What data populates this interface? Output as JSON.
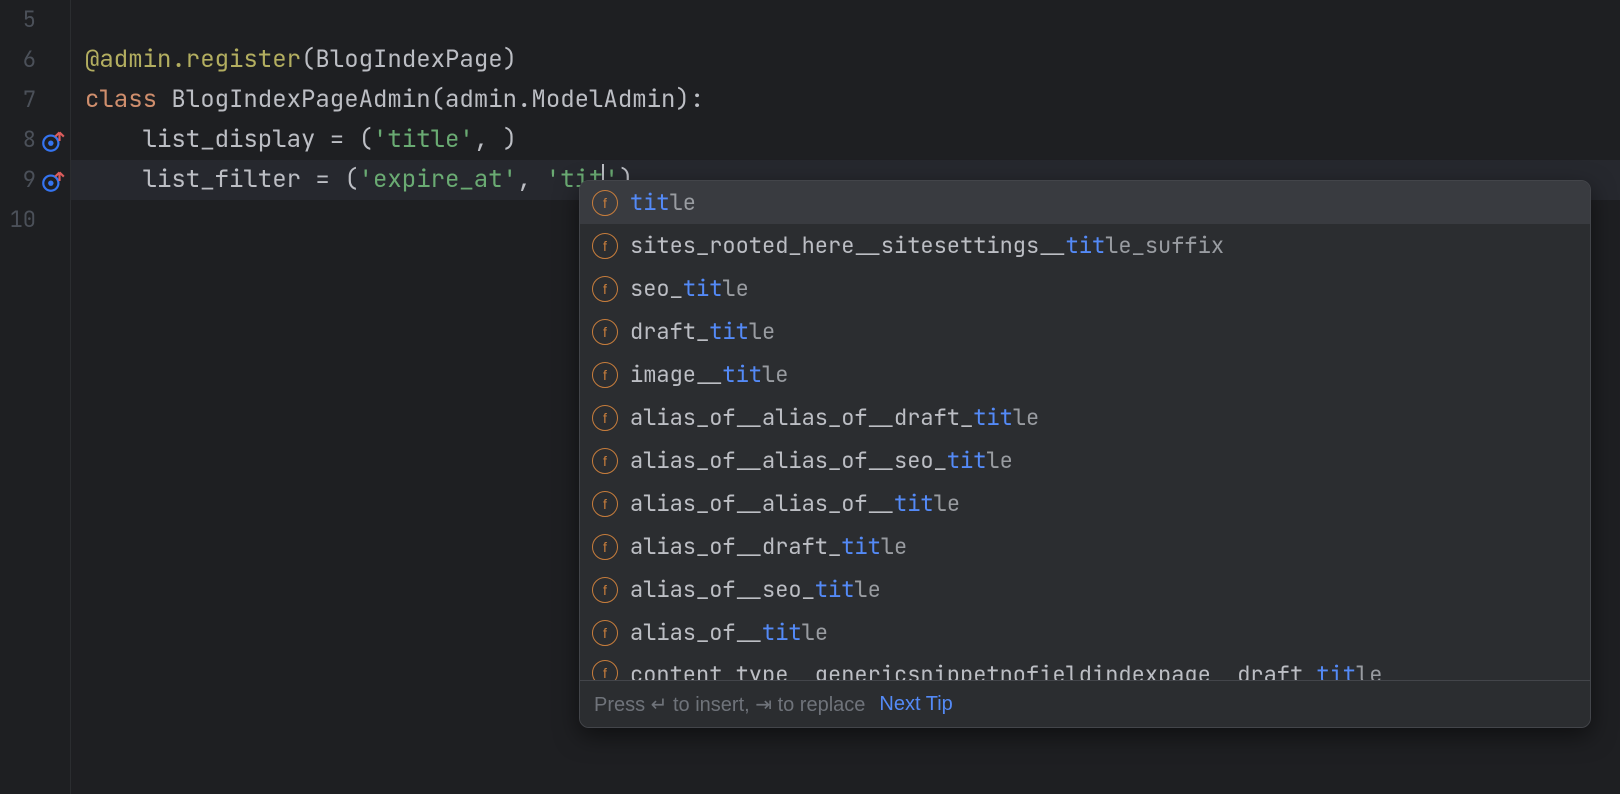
{
  "lines": {
    "5": "5",
    "6": "6",
    "7": "7",
    "8": "8",
    "9": "9",
    "10": "10"
  },
  "code": {
    "l6": {
      "decorator_at": "@",
      "decorator_name": "admin.register",
      "paren_open": "(",
      "arg": "BlogIndexPage",
      "paren_close": ")"
    },
    "l7": {
      "kw_class": "class ",
      "name": "BlogIndexPageAdmin",
      "paren_open": "(",
      "base": "admin.ModelAdmin",
      "paren_close": "):"
    },
    "l8": {
      "indent": "    ",
      "attr": "list_display = (",
      "s1": "'title'",
      "rest": ", )"
    },
    "l9": {
      "indent": "    ",
      "attr": "list_filter = (",
      "s1": "'expire_at'",
      "mid": ", ",
      "s2a": "'tit",
      "s2b": "'",
      "rest": ")"
    }
  },
  "completion": {
    "badge": "f",
    "items": [
      {
        "parts": [
          {
            "t": "tit",
            "hl": true
          },
          {
            "t": "le",
            "hl": false,
            "rest": true
          }
        ]
      },
      {
        "parts": [
          {
            "t": "sites_rooted_here__sitesettings__",
            "hl": false
          },
          {
            "t": "tit",
            "hl": true
          },
          {
            "t": "le_suffix",
            "hl": false,
            "rest": true
          }
        ]
      },
      {
        "parts": [
          {
            "t": "seo_",
            "hl": false
          },
          {
            "t": "tit",
            "hl": true
          },
          {
            "t": "le",
            "hl": false,
            "rest": true
          }
        ]
      },
      {
        "parts": [
          {
            "t": "draft_",
            "hl": false
          },
          {
            "t": "tit",
            "hl": true
          },
          {
            "t": "le",
            "hl": false,
            "rest": true
          }
        ]
      },
      {
        "parts": [
          {
            "t": "image__",
            "hl": false
          },
          {
            "t": "tit",
            "hl": true
          },
          {
            "t": "le",
            "hl": false,
            "rest": true
          }
        ]
      },
      {
        "parts": [
          {
            "t": "alias_of__alias_of__draft_",
            "hl": false
          },
          {
            "t": "tit",
            "hl": true
          },
          {
            "t": "le",
            "hl": false,
            "rest": true
          }
        ]
      },
      {
        "parts": [
          {
            "t": "alias_of__alias_of__seo_",
            "hl": false
          },
          {
            "t": "tit",
            "hl": true
          },
          {
            "t": "le",
            "hl": false,
            "rest": true
          }
        ]
      },
      {
        "parts": [
          {
            "t": "alias_of__alias_of__",
            "hl": false
          },
          {
            "t": "tit",
            "hl": true
          },
          {
            "t": "le",
            "hl": false,
            "rest": true
          }
        ]
      },
      {
        "parts": [
          {
            "t": "alias_of__draft_",
            "hl": false
          },
          {
            "t": "tit",
            "hl": true
          },
          {
            "t": "le",
            "hl": false,
            "rest": true
          }
        ]
      },
      {
        "parts": [
          {
            "t": "alias_of__seo_",
            "hl": false
          },
          {
            "t": "tit",
            "hl": true
          },
          {
            "t": "le",
            "hl": false,
            "rest": true
          }
        ]
      },
      {
        "parts": [
          {
            "t": "alias_of__",
            "hl": false
          },
          {
            "t": "tit",
            "hl": true
          },
          {
            "t": "le",
            "hl": false,
            "rest": true
          }
        ]
      },
      {
        "parts": [
          {
            "t": "content_type__genericsnippetnofieldindexpage__draft_",
            "hl": false
          },
          {
            "t": "tit",
            "hl": true
          },
          {
            "t": "le",
            "hl": false,
            "rest": true
          }
        ]
      }
    ],
    "footer_text": "Press ↵ to insert, ⇥ to replace",
    "next_tip": "Next Tip"
  }
}
